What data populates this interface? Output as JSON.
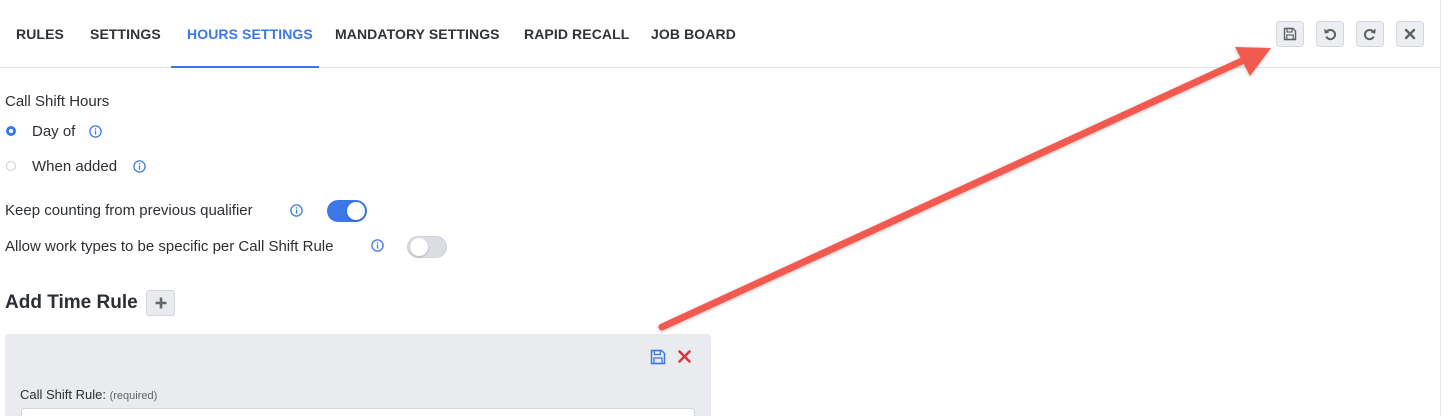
{
  "tabs": [
    {
      "label": "RULES",
      "active": false
    },
    {
      "label": "SETTINGS",
      "active": false
    },
    {
      "label": "HOURS SETTINGS",
      "active": true
    },
    {
      "label": "MANDATORY SETTINGS",
      "active": false
    },
    {
      "label": "RAPID RECALL",
      "active": false
    },
    {
      "label": "JOB BOARD",
      "active": false
    }
  ],
  "toolbar": {
    "buttons": [
      {
        "icon": "save-icon"
      },
      {
        "icon": "undo-icon"
      },
      {
        "icon": "redo-icon"
      },
      {
        "icon": "close-icon"
      }
    ]
  },
  "call_shift_hours": {
    "label": "Call Shift Hours",
    "options": [
      {
        "label": "Day of",
        "selected": true
      },
      {
        "label": "When added",
        "selected": false
      }
    ]
  },
  "settings": {
    "keep_counting": {
      "label": "Keep counting from previous qualifier",
      "enabled": true
    },
    "allow_work_types": {
      "label": "Allow work types to be specific per Call Shift Rule",
      "enabled": false
    }
  },
  "time_rule": {
    "heading": "Add Time Rule",
    "card": {
      "field_label": "Call Shift Rule:",
      "field_hint": "(required)"
    }
  },
  "colors": {
    "accent": "#3b78e7",
    "delete": "#d9363e",
    "annotation_arrow": "#f25a4f"
  }
}
